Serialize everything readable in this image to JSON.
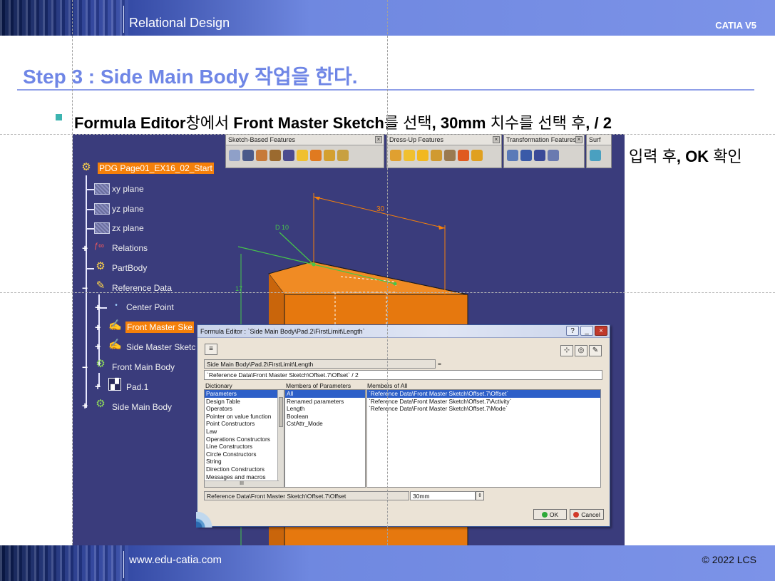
{
  "header": {
    "title": "Relational Design",
    "brand": "CATIA V5"
  },
  "footer": {
    "site": "www.edu-catia.com",
    "copyright": "© 2022 LCS"
  },
  "step": {
    "title": "Step 3 : Side Main Body 작업을 한다."
  },
  "instruction": {
    "part1": "Formula Editor",
    "part2": "창에서 ",
    "part3": "Front Master Sketch",
    "part4": "를 선택",
    "part5": ", 30mm",
    "part6": " 치수를 선택 후",
    "part7": ", / 2",
    "line2a": "입력 후",
    "line2b": ", OK",
    "line2c": " 확인"
  },
  "toolbars": [
    {
      "name": "Sketch-Based Features",
      "icon_count": 9
    },
    {
      "name": "Dress-Up Features",
      "icon_count": 7
    },
    {
      "name": "Transformation Features",
      "icon_count": 4
    },
    {
      "name": "Surf",
      "icon_count": 1
    }
  ],
  "tree": {
    "root": "PDG Page01_EX16_02_Start",
    "xy_plane": "xy plane",
    "yz_plane": "yz plane",
    "zx_plane": "zx plane",
    "relations": "Relations",
    "partbody": "PartBody",
    "reference_data": "Reference Data",
    "center_point": "Center Point",
    "front_master_sketch": "Front Master Ske",
    "side_master_sketch": "Side Master Sketc",
    "front_main_body": "Front Main Body",
    "pad1": "Pad.1",
    "side_main_body": "Side Main Body"
  },
  "geometry_labels": {
    "dim_30": "30",
    "dim_d10": "D 10",
    "dim_v": "17"
  },
  "dialog": {
    "title": "Formula Editor : `Side Main Body\\Pad.2\\FirstLimit\\Length`",
    "param_path": "Side Main Body\\Pad.2\\FirstLimit\\Length",
    "equals": "=",
    "formula": "`Reference Data\\Front Master Sketch\\Offset.7\\Offset` / 2",
    "dictionary_label": "Dictionary",
    "members_params_label": "Members of Parameters",
    "members_all_label": "Members of All",
    "dictionary": [
      "Parameters",
      "Design Table",
      "Operators",
      "Pointer on value function",
      "Point Constructors",
      "Law",
      "Operations Constructors",
      "Line Constructors",
      "Circle Constructors",
      "String",
      "Direction Constructors",
      "Messages and macros"
    ],
    "dictionary_selected": 0,
    "members_params": [
      "All",
      "Renamed parameters",
      "Length",
      "Boolean",
      "CstAttr_Mode"
    ],
    "members_params_selected": 0,
    "members_all": [
      "`Reference Data\\Front Master Sketch\\Offset.7\\Offset`",
      "`Reference Data\\Front Master Sketch\\Offset.7\\Activity`",
      "`Reference Data\\Front Master Sketch\\Offset.7\\Mode`"
    ],
    "members_all_selected": 0,
    "selected_path": "Reference Data\\Front Master Sketch\\Offset.7\\Offset",
    "selected_value": "30mm",
    "ok_label": "OK",
    "cancel_label": "Cancel",
    "help_button": "?",
    "hscroll_label": "III"
  },
  "colors": {
    "accent_title": "#6f86e6",
    "viewport_bg": "#3a3c7c",
    "solid_orange": "#e97a10",
    "highlight": "#f5800a"
  }
}
